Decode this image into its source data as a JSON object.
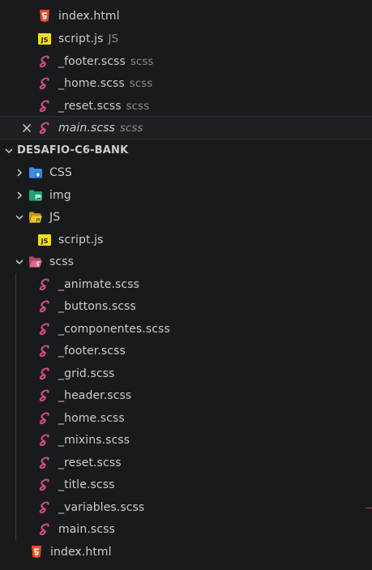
{
  "open_editors": [
    {
      "label": "index.html",
      "icon": "html-icon",
      "desc": ""
    },
    {
      "label": "script.js",
      "icon": "js-icon",
      "desc": "JS"
    },
    {
      "label": "_footer.scss",
      "icon": "sass-icon",
      "desc": "scss"
    },
    {
      "label": "_home.scss",
      "icon": "sass-icon",
      "desc": "scss"
    },
    {
      "label": "_reset.scss",
      "icon": "sass-icon",
      "desc": "scss"
    },
    {
      "label": "main.scss",
      "icon": "sass-icon",
      "desc": "scss",
      "italic": true
    }
  ],
  "project": {
    "title": "DESAFIO-C6-BANK",
    "folders": {
      "css": "CSS",
      "img": "img",
      "js": "JS",
      "scss": "scss"
    },
    "js_files": [
      "script.js"
    ],
    "scss_files": [
      "_animate.scss",
      "_buttons.scss",
      "_componentes.scss",
      "_footer.scss",
      "_grid.scss",
      "_header.scss",
      "_home.scss",
      "_mixins.scss",
      "_reset.scss",
      "_title.scss",
      "_variables.scss",
      "main.scss"
    ],
    "root_files": [
      "index.html"
    ]
  },
  "colors": {
    "background": "#191a1e",
    "sass": "#cd4c7e",
    "html": "#e44d26",
    "js": "#f5de19",
    "css_folder": "#3f8ee6",
    "img_folder": "#1fa27a",
    "js_folder": "#f2c12e",
    "scss_folder": "#e06a8f"
  }
}
